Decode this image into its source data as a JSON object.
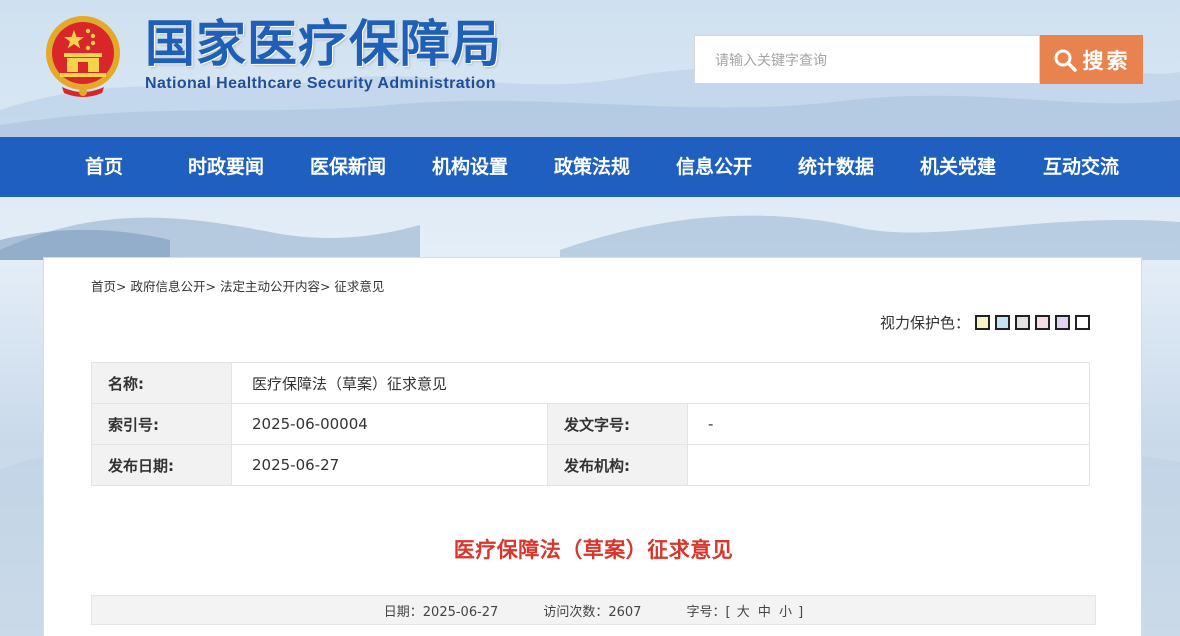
{
  "header": {
    "title_cn": "国家医疗保障局",
    "title_en": "National Healthcare Security Administration",
    "search_placeholder": "请输入关键字查询",
    "search_button": "搜索"
  },
  "nav": {
    "items": [
      "首页",
      "时政要闻",
      "医保新闻",
      "机构设置",
      "政策法规",
      "信息公开",
      "统计数据",
      "机关党建",
      "互动交流"
    ]
  },
  "breadcrumb": [
    "首页",
    "政府信息公开",
    "法定主动公开内容",
    "征求意见"
  ],
  "eye_care": {
    "label": "视力保护色：",
    "colors": [
      "#f8f3c4",
      "#c5e3f2",
      "#e2e2e2",
      "#f9dbe3",
      "#e2d3f3",
      "#ffffff"
    ]
  },
  "meta": {
    "name_label": "名称:",
    "name_value": "医疗保障法（草案）征求意见",
    "index_label": "索引号:",
    "index_value": "2025-06-00004",
    "doc_no_label": "发文字号:",
    "doc_no_value": "-",
    "date_label": "发布日期:",
    "date_value": "2025-06-27",
    "org_label": "发布机构:",
    "org_value": ""
  },
  "article": {
    "title": "医疗保障法（草案）征求意见",
    "date_label": "日期：",
    "date_value": "2025-06-27",
    "visits_label": "访问次数：",
    "visits_value": "2607",
    "font_label": "字号：",
    "font_sizes": [
      "大",
      "中",
      "小"
    ]
  },
  "colors": {
    "nav_bg": "#1e5fc0",
    "search_button_bg": "#e8824f",
    "title_red": "#d8352b",
    "logo_blue": "#1f5fb6"
  }
}
